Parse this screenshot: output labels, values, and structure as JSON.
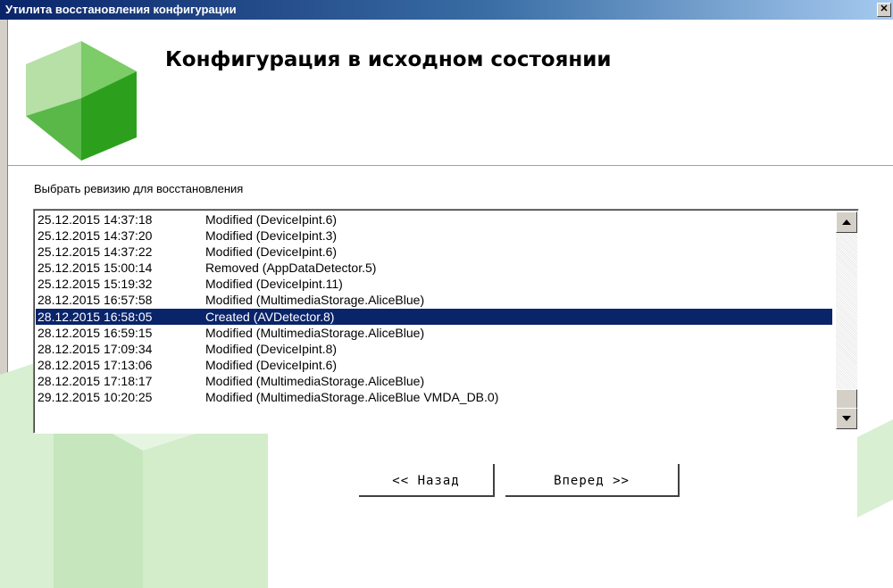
{
  "window": {
    "title": "Утилита восстановления конфигурации",
    "close_label": "✕"
  },
  "header": {
    "heading": "Конфигурация в исходном состоянии"
  },
  "instruction": "Выбрать ревизию для восстановления",
  "revisions": [
    {
      "date": "25.12.2015 14:37:18",
      "action": "Modified (DeviceIpint.6)"
    },
    {
      "date": "25.12.2015 14:37:20",
      "action": "Modified (DeviceIpint.3)"
    },
    {
      "date": "25.12.2015 14:37:22",
      "action": "Modified (DeviceIpint.6)"
    },
    {
      "date": "25.12.2015 15:00:14",
      "action": "Removed (AppDataDetector.5)"
    },
    {
      "date": "25.12.2015 15:19:32",
      "action": "Modified (DeviceIpint.11)"
    },
    {
      "date": "28.12.2015 16:57:58",
      "action": "Modified (MultimediaStorage.AliceBlue)"
    },
    {
      "date": "28.12.2015 16:58:05",
      "action": "Created (AVDetector.8)"
    },
    {
      "date": "28.12.2015 16:59:15",
      "action": "Modified (MultimediaStorage.AliceBlue)"
    },
    {
      "date": "28.12.2015 17:09:34",
      "action": "Modified (DeviceIpint.8)"
    },
    {
      "date": "28.12.2015 17:13:06",
      "action": "Modified (DeviceIpint.6)"
    },
    {
      "date": "28.12.2015 17:18:17",
      "action": "Modified (MultimediaStorage.AliceBlue)"
    },
    {
      "date": "29.12.2015 10:20:25",
      "action": "Modified (MultimediaStorage.AliceBlue VMDA_DB.0)"
    }
  ],
  "selected_index": 6,
  "buttons": {
    "back": "<< Назад",
    "next": "Вперед >>"
  },
  "colors": {
    "selection": "#0a246a",
    "accent_green": "#2ca01c"
  }
}
